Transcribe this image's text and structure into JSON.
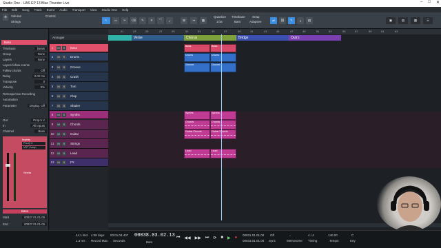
{
  "window": {
    "title": "Studio One - UAS EP 13 Blue Thunder Live",
    "buttons": [
      "–",
      "□",
      "✕"
    ]
  },
  "menu": [
    "File",
    "Edit",
    "Song",
    "Track",
    "Event",
    "Audio",
    "Transport",
    "View",
    "Studio One",
    "Help"
  ],
  "toolbar": {
    "volume_label": "Volume",
    "track_name": "Strings",
    "control_label": "Control",
    "quantize_label": "Quantize",
    "quantize_value": "1/16",
    "timebase_label": "Timebase",
    "timebase_value": "Bars",
    "snap_label": "Snap",
    "snap_value": "Adaptive"
  },
  "inspector": {
    "track_title": "Bass",
    "rows": [
      {
        "label": "Timebase",
        "value": "Beats"
      },
      {
        "label": "Group",
        "value": "None"
      },
      {
        "label": "Layers",
        "value": "None"
      },
      {
        "label": "Layers follow events",
        "value": ""
      },
      {
        "label": "Follow chords",
        "value": "Off"
      },
      {
        "label": "Delay",
        "value": "0.00 ms"
      },
      {
        "label": "Transpose",
        "value": "0"
      },
      {
        "label": "Velocity",
        "value": "0%"
      },
      {
        "label": "Retrospective Recording",
        "value": ""
      },
      {
        "label": "Automation",
        "value": ""
      },
      {
        "label": "Parameter",
        "value": "Display: Off"
      }
    ],
    "out_label": "Out",
    "out_value": "Prop 5 V",
    "in_label": "In",
    "in_value": "All Inputs",
    "channel_label": "Channel",
    "channel_value": "Bass",
    "inserts_label": "Inserts",
    "insert1": "Pro-Q 3",
    "insert2": "VST Comp",
    "sends_label": "Sends",
    "channel_name": "Bass",
    "start_label": "Start",
    "start_value": "00037.01.01.00",
    "end_label": "End",
    "end_value": "00037.01.01.00"
  },
  "tracklist": {
    "arranger_label": "Arranger",
    "tracks": [
      {
        "num": "1",
        "name": "Bass",
        "color": "#e0506a"
      },
      {
        "num": "2",
        "name": "Drums",
        "color": "#3a7bd5"
      },
      {
        "num": "3",
        "name": "Groove",
        "color": "#3a7bd5"
      },
      {
        "num": "4",
        "name": "Crash",
        "color": "#3a7bd5"
      },
      {
        "num": "5",
        "name": "Tom",
        "color": "#3a7bd5"
      },
      {
        "num": "6",
        "name": "Clap",
        "color": "#3a7bd5"
      },
      {
        "num": "7",
        "name": "Shaker",
        "color": "#3a7bd5"
      },
      {
        "num": "8",
        "name": "Synths",
        "color": "#c0409a"
      },
      {
        "num": "9",
        "name": "Chords",
        "color": "#c0409a"
      },
      {
        "num": "10",
        "name": "Guitar",
        "color": "#c0409a"
      },
      {
        "num": "11",
        "name": "Strings",
        "color": "#c0409a"
      },
      {
        "num": "12",
        "name": "Lead",
        "color": "#c0409a"
      },
      {
        "num": "13",
        "name": "FX",
        "color": "#7a5acd"
      }
    ]
  },
  "ruler": [
    "21",
    "23",
    "25",
    "27",
    "29",
    "31",
    "33",
    "35",
    "37",
    "39",
    "41",
    "43",
    "45",
    "47",
    "49",
    "51",
    "53",
    "55",
    "57",
    "59",
    "61",
    "63"
  ],
  "sections": [
    {
      "name": "",
      "color": "#2fb3a8"
    },
    {
      "name": "Verse",
      "color": "#2f5c8a"
    },
    {
      "name": "Chorus",
      "color": "#7ea03a"
    },
    {
      "name": "Bridge",
      "color": "#3a4fb0"
    },
    {
      "name": "Outro",
      "color": "#7a3fb0"
    }
  ],
  "clips": [
    {
      "label": "Bass",
      "color": "#d94a6a"
    },
    {
      "label": "Bass",
      "color": "#d94a6a"
    },
    {
      "label": "Drums",
      "color": "#3570c8"
    },
    {
      "label": "Drums",
      "color": "#3570c8"
    },
    {
      "label": "Groove",
      "color": "#3570c8"
    },
    {
      "label": "Groove",
      "color": "#3570c8"
    },
    {
      "label": "Synths",
      "color": "#c03c94"
    },
    {
      "label": "Synths",
      "color": "#c03c94"
    },
    {
      "label": "Chords",
      "color": "#c03c94"
    },
    {
      "label": "Chords",
      "color": "#c03c94"
    },
    {
      "label": "Guitar Chords",
      "color": "#c03c94"
    },
    {
      "label": "Guitar Chords",
      "color": "#c03c94"
    },
    {
      "label": "Lead",
      "color": "#c03c94"
    },
    {
      "label": "Lead",
      "color": "#c03c94"
    }
  ],
  "transport": {
    "sample_rate": "44.1 kHz",
    "latency": "1.3 ms",
    "record_time": "4:08 days",
    "record_label": "Record Max",
    "time_seconds": "00:01:04.407",
    "time_seconds_label": "Seconds",
    "bars_position": "00038.03.02.13",
    "bars_label": "Bars",
    "loop_start": "00031.01.01.00",
    "loop_end": "00033.01.01.00",
    "sync_label": "Off",
    "sync_value": "Sync",
    "metronome_label": "Metronome",
    "timing_label": "Timing",
    "time_sig": "4 / 4",
    "tempo_label": "Tempo",
    "tempo_value": "140.00",
    "key_label": "Key",
    "key_value": "C"
  },
  "colors": {
    "accent": "#3c8fe0",
    "bass": "#e0506a",
    "drums": "#3a7bd5",
    "synths": "#c0409a",
    "playhead": "#9ad0ff"
  }
}
